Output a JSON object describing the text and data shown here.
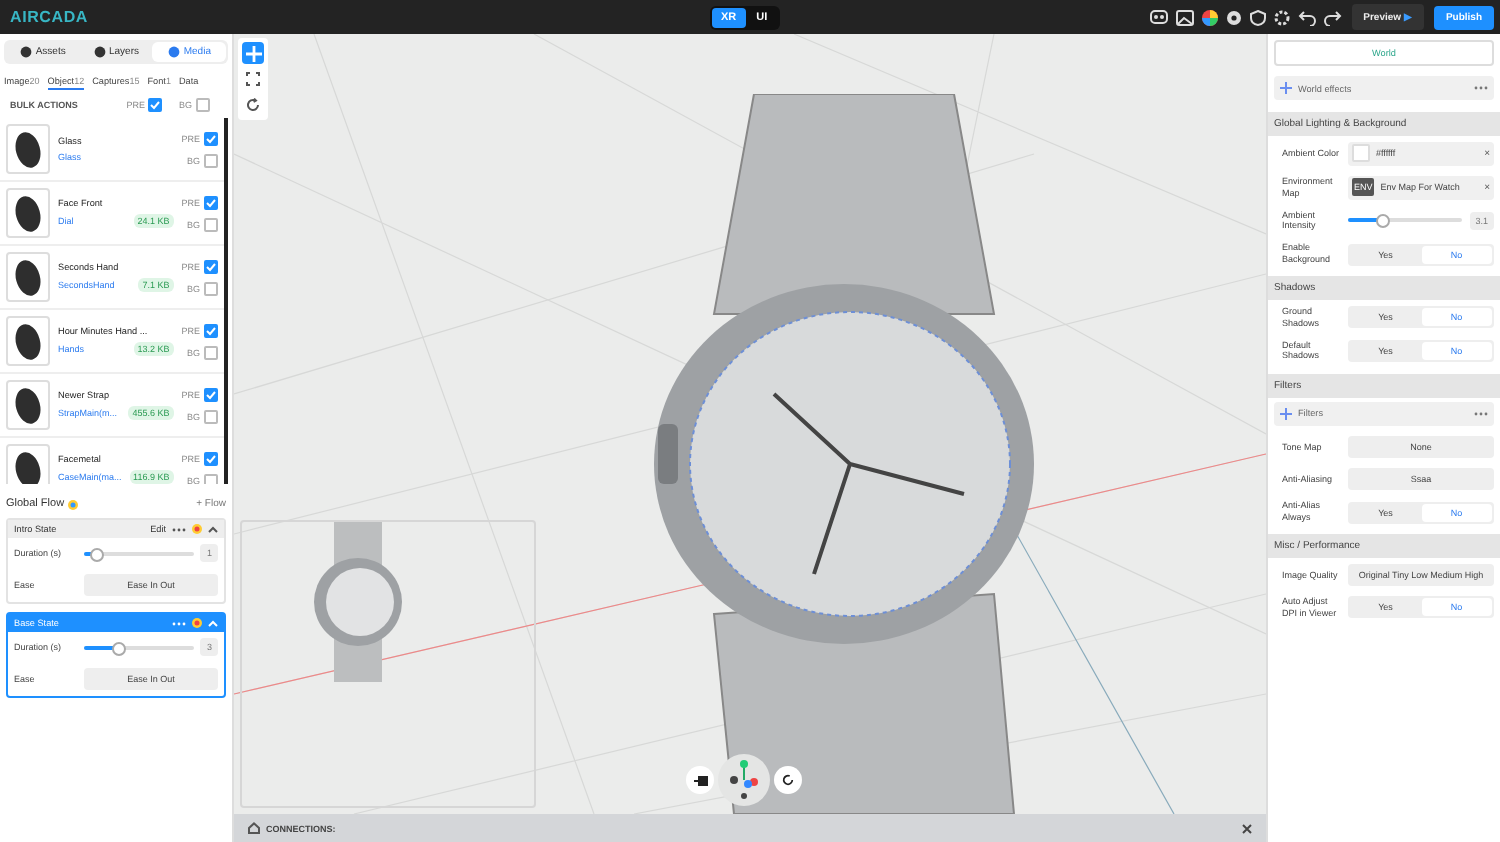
{
  "topbar": {
    "logo": "AIRCADA",
    "modes": [
      {
        "label": "XR",
        "selected": true
      },
      {
        "label": "UI",
        "selected": false
      }
    ],
    "preview": "Preview",
    "preview_icon": "▶",
    "publish": "Publish"
  },
  "left": {
    "panel_tabs": [
      {
        "label": "Assets",
        "selected": false
      },
      {
        "label": "Layers",
        "selected": false
      },
      {
        "label": "Media",
        "selected": true
      }
    ],
    "file_tabs": [
      {
        "label": "Image",
        "count": "20",
        "selected": false
      },
      {
        "label": "Object",
        "count": "12",
        "selected": true
      },
      {
        "label": "Captures",
        "count": "15",
        "selected": false
      },
      {
        "label": "Font",
        "count": "1",
        "selected": false
      },
      {
        "label": "Data",
        "selected": false
      }
    ],
    "bulk": {
      "label": "BULK ACTIONS",
      "pre": "PRE",
      "pre_checked": true,
      "bg": "BG",
      "bg_checked": false
    },
    "assets": [
      {
        "name": "Glass",
        "sub": "Glass",
        "pre": "PRE",
        "pre_checked": true,
        "bg": "BG",
        "bg_checked": false
      },
      {
        "name": "Face Front",
        "sub": "Dial",
        "size": "24.1 KB",
        "pre": "PRE",
        "pre_checked": true,
        "bg": "BG",
        "bg_checked": false
      },
      {
        "name": "Seconds Hand",
        "sub": "SecondsHand",
        "size": "7.1 KB",
        "pre": "PRE",
        "pre_checked": true,
        "bg": "BG",
        "bg_checked": false
      },
      {
        "name": "Hour Minutes Hand ...",
        "sub": "Hands",
        "size": "13.2 KB",
        "pre": "PRE",
        "pre_checked": true,
        "bg": "BG",
        "bg_checked": false
      },
      {
        "name": "Newer Strap",
        "sub": "StrapMain(m...",
        "size": "455.6 KB",
        "pre": "PRE",
        "pre_checked": true,
        "bg": "BG",
        "bg_checked": false
      },
      {
        "name": "Facemetal",
        "sub": "CaseMain(ma...",
        "size": "116.9 KB",
        "pre": "PRE",
        "pre_checked": true,
        "bg": "BG",
        "bg_checked": false
      }
    ],
    "flow": {
      "title": "Global Flow",
      "add": "+ Flow",
      "states": [
        {
          "name": "Intro State",
          "edit": "Edit",
          "selected": false,
          "duration_label": "Duration (s)",
          "level": 0.1,
          "duration": "1",
          "ease_label": "Ease",
          "ease": "Ease In Out"
        },
        {
          "name": "Base State",
          "selected": true,
          "duration_label": "Duration (s)",
          "level": 0.3,
          "duration": "3",
          "ease_label": "Ease",
          "ease": "Ease In Out"
        }
      ]
    }
  },
  "viewport": {
    "connections": "CONNECTIONS:"
  },
  "right": {
    "world": "World",
    "world_effects": "World effects",
    "sections": [
      {
        "title": "Global Lighting & Background",
        "rows": [
          {
            "kind": "color",
            "label": "Ambient Color",
            "value": "#ffffff",
            "clear": "×"
          },
          {
            "kind": "asset",
            "label": "Environment Map",
            "thumb": "ENV",
            "value": "Env Map For Watch",
            "clear": "×"
          },
          {
            "kind": "slider",
            "label": "Ambient Intensity",
            "level": 0.3,
            "value": "3.1"
          },
          {
            "kind": "toggle",
            "label": "Enable Background",
            "yes": "Yes",
            "no": "No",
            "on": false
          }
        ]
      },
      {
        "title": "Shadows",
        "rows": [
          {
            "kind": "toggle",
            "label": "Ground Shadows",
            "yes": "Yes",
            "no": "No",
            "on": false
          },
          {
            "kind": "toggle",
            "label": "Default Shadows",
            "yes": "Yes",
            "no": "No",
            "on": false
          }
        ]
      },
      {
        "title": "Filters",
        "rows": [
          {
            "kind": "effect",
            "label": "Filters"
          },
          {
            "kind": "select",
            "label": "Tone Map",
            "value": "None"
          },
          {
            "kind": "select",
            "label": "Anti-Aliasing",
            "value": "Ssaa"
          },
          {
            "kind": "toggle",
            "label": "Anti-Alias Always",
            "yes": "Yes",
            "no": "No",
            "on": false
          }
        ]
      },
      {
        "title": "Misc / Performance",
        "rows": [
          {
            "kind": "select",
            "label": "Image Quality",
            "value": "Original Tiny Low Medium High"
          },
          {
            "kind": "toggle",
            "label": "Auto Adjust DPI in Viewer",
            "yes": "Yes",
            "no": "No",
            "on": false
          }
        ]
      }
    ]
  }
}
